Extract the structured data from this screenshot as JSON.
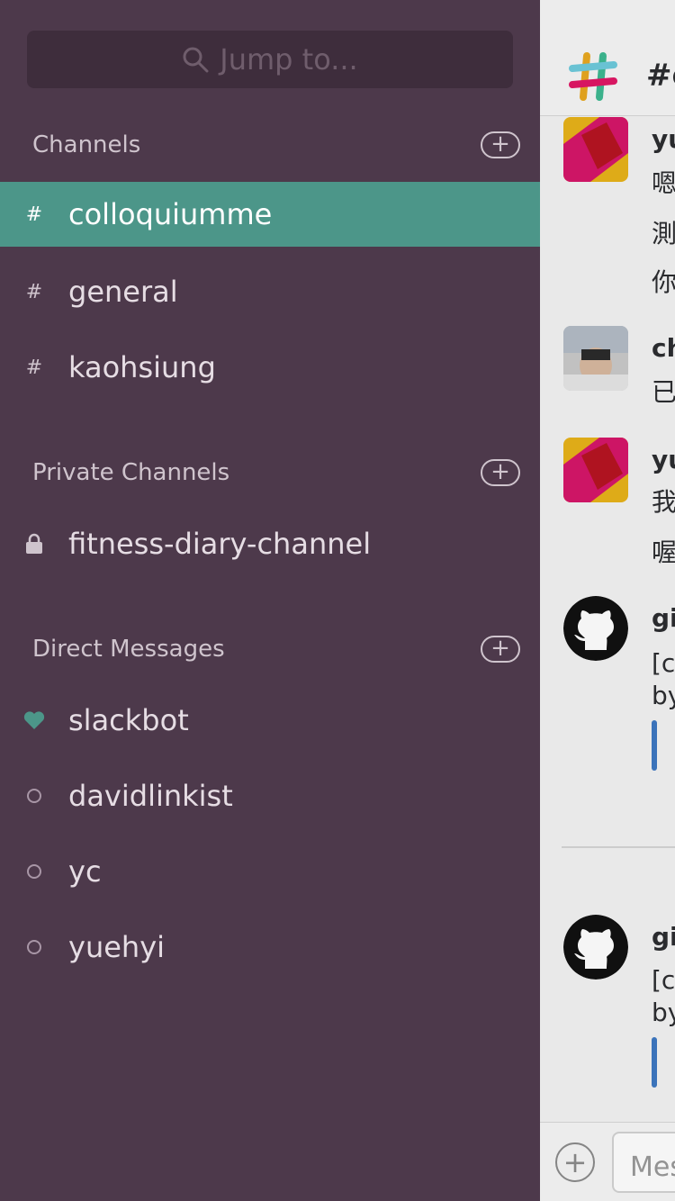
{
  "search": {
    "placeholder": "Jump to..."
  },
  "sections": {
    "channels": {
      "title": "Channels",
      "items": [
        {
          "label": "colloquiumme",
          "prefix": "#",
          "active": true
        },
        {
          "label": "general",
          "prefix": "#",
          "active": false
        },
        {
          "label": "kaohsiung",
          "prefix": "#",
          "active": false
        }
      ]
    },
    "private_channels": {
      "title": "Private Channels",
      "items": [
        {
          "label": "fitness-diary-channel",
          "icon": "lock-icon"
        }
      ]
    },
    "direct_messages": {
      "title": "Direct Messages",
      "items": [
        {
          "label": "slackbot",
          "icon": "heart-icon"
        },
        {
          "label": "davidlinkist",
          "icon": "presence-away-icon"
        },
        {
          "label": "yc",
          "icon": "presence-away-icon"
        },
        {
          "label": "yuehyi",
          "icon": "presence-away-icon"
        }
      ]
    }
  },
  "main": {
    "channel_title": "#c",
    "messages": [
      {
        "author": "yu",
        "lines": [
          "嗯",
          "測",
          "你"
        ]
      },
      {
        "author": "ch",
        "lines": [
          "已"
        ]
      },
      {
        "author": "yu",
        "lines": [
          "我",
          "喔"
        ]
      },
      {
        "author": "gi",
        "lines": [
          "[co",
          "by"
        ]
      },
      {
        "author": "gi",
        "lines": [
          "[co",
          "by"
        ]
      }
    ],
    "composer_placeholder": "Mes"
  },
  "colors": {
    "sidebar_bg": "#4d394b",
    "active_row": "#4c9689",
    "link_bar": "#3e78c2"
  }
}
